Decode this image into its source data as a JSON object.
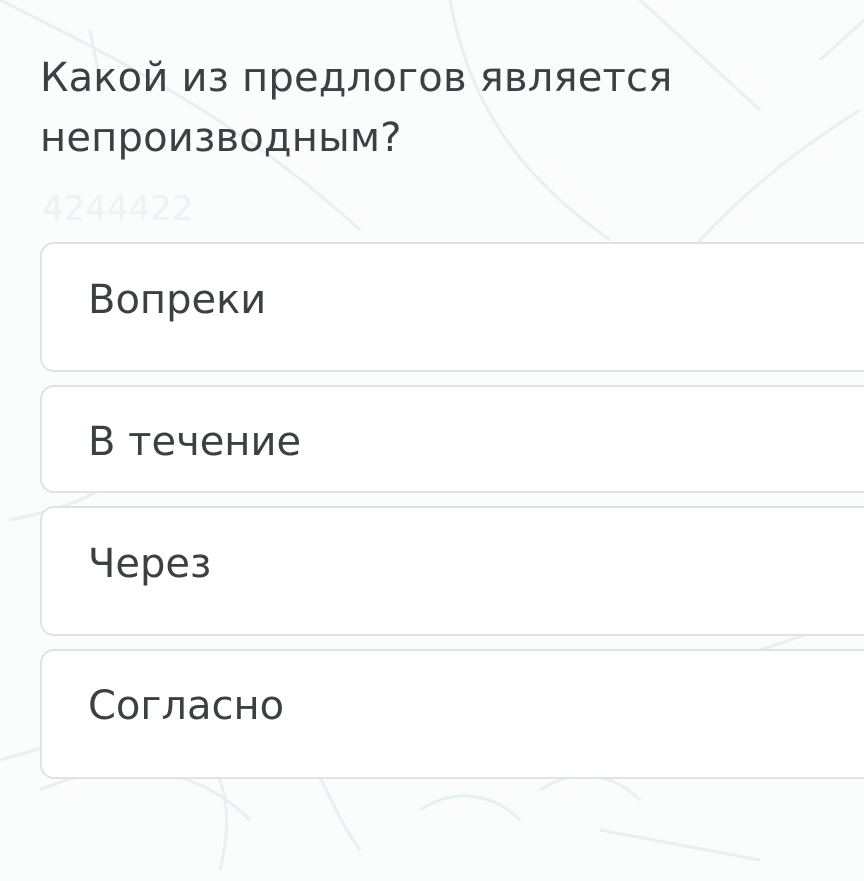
{
  "quiz": {
    "question": "Какой из предлогов является непроизводным?",
    "options": [
      {
        "label": "Вопреки"
      },
      {
        "label": "В течение"
      },
      {
        "label": "Через"
      },
      {
        "label": "Согласно"
      }
    ]
  },
  "background": {
    "pattern": "faint mathematics doodles",
    "faint_text": "4244422"
  },
  "colors": {
    "page_background": "#fbfcfc",
    "text": "#3c4043",
    "option_border": "#dfe3e6",
    "option_background": "#ffffff",
    "pattern": "#e8f1f3"
  }
}
